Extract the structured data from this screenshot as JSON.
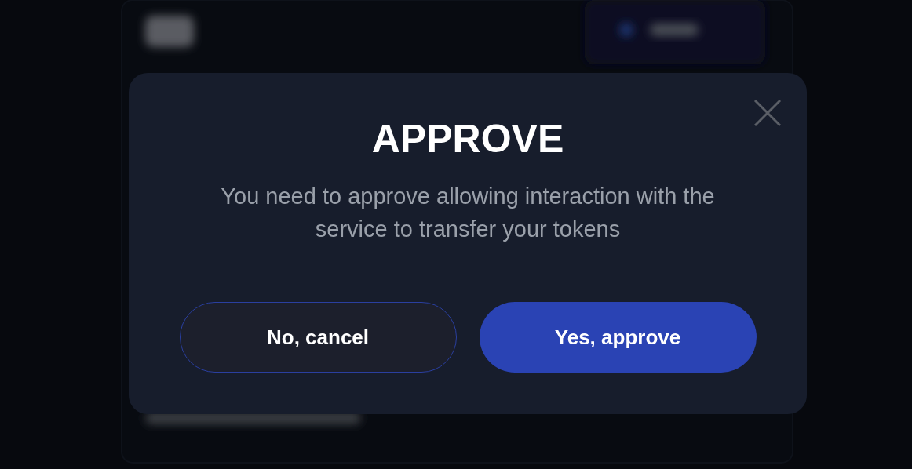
{
  "dialog": {
    "title": "APPROVE",
    "message": "You need to approve allowing interaction with the service to transfer your tokens",
    "buttons": [
      {
        "label": "No, cancel",
        "kind": "secondary"
      },
      {
        "label": "Yes, approve",
        "kind": "primary"
      }
    ]
  }
}
